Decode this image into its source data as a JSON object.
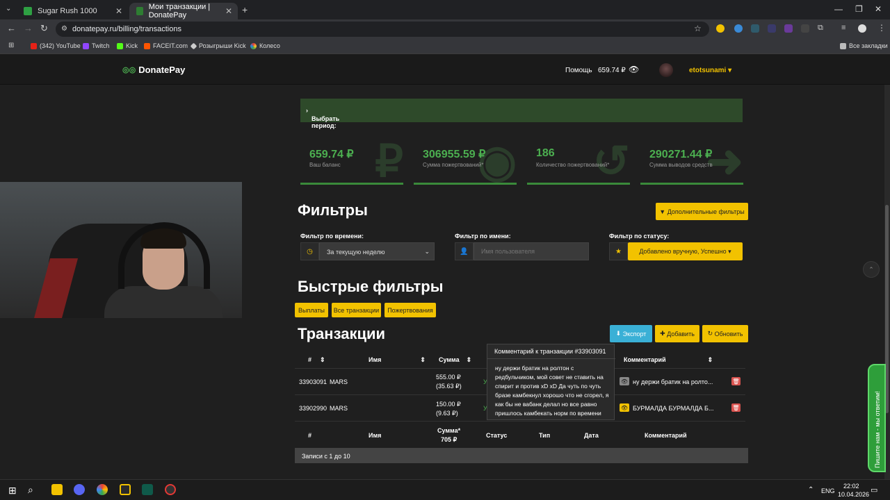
{
  "browser": {
    "tabs": [
      {
        "title": "Sugar Rush 1000",
        "active": false
      },
      {
        "title": "Мои транзакции | DonatePay",
        "active": true
      }
    ],
    "url": "donatepay.ru/billing/transactions",
    "bookmarks": [
      "(342) YouTube",
      "Twitch",
      "Kick",
      "FACEIT.com",
      "Розыгрыши Kick",
      "Колесо"
    ],
    "all_bookmarks": "Все закладки"
  },
  "header": {
    "logo": "DonatePay",
    "help": "Помощь",
    "balance": "659.74 ₽",
    "username": "etotsunami"
  },
  "period": {
    "label": "Выбрать период:"
  },
  "stats": [
    {
      "value": "659.74 ₽",
      "label": "Ваш баланс",
      "icon": "ruble-icon"
    },
    {
      "value": "306955.59 ₽",
      "label": "Сумма пожертвований*",
      "icon": "coin-icon"
    },
    {
      "value": "186",
      "label": "Количество пожертвований*",
      "icon": "refresh-icon"
    },
    {
      "value": "290271.44 ₽",
      "label": "Сумма выводов средств",
      "icon": "arrow-icon"
    }
  ],
  "filters": {
    "title": "Фильтры",
    "more_button": "Дополнительные фильтры",
    "time_label": "Фильтр по времени:",
    "time_value": "За текущую неделю",
    "name_label": "Фильтр по имени:",
    "name_placeholder": "Имя пользователя",
    "status_label": "Фильтр по статусу:",
    "status_value": "Добавлено вручную, Успешно"
  },
  "quick_filters": {
    "title": "Быстрые фильтры",
    "buttons": [
      "Выплаты",
      "Все транзакции",
      "Пожертвования"
    ]
  },
  "transactions": {
    "title": "Транзакции",
    "export": "Экспорт",
    "add": "Добавить",
    "refresh": "Обновить",
    "columns": [
      "#",
      "Имя",
      "Сумма",
      "Статус",
      "Тип",
      "Дата",
      "Комментарий"
    ],
    "rows": [
      {
        "id": "33903091",
        "name": "MARS",
        "amount": "555.00 ₽",
        "amount_sub": "(35.63 ₽)",
        "status_partial": "У",
        "comment": "ну держи братик на ролто..."
      },
      {
        "id": "33902990",
        "name": "MARS",
        "amount": "150.00 ₽",
        "amount_sub": "(9.63 ₽)",
        "status_partial": "У",
        "comment": "БУРМАЛДА БУРМАЛДА Б..."
      }
    ],
    "footer_sum_label": "Сумма*",
    "footer_sum_value": "705 ₽",
    "records": "Записи с 1 до 10"
  },
  "tooltip": {
    "title": "Комментарий к транзакции #33903091",
    "body": "ну держи братик на ролтон с редбульчиком, мой совет не ставить на спирит и против xD xD Да чуть по чуть бразе камбекнул хорошо что не сгорел, я как бы не вабанк делал но все равно пришлось камбекать норм по времени"
  },
  "chat_widget": "Пишите нам - мы ответим!",
  "taskbar": {
    "lang": "ENG",
    "time": "22:02",
    "date": "10.04.2026"
  },
  "colors": {
    "accent_green": "#4caf50",
    "accent_yellow": "#f2c200",
    "accent_blue": "#3ab0d6",
    "danger": "#d9534f"
  }
}
